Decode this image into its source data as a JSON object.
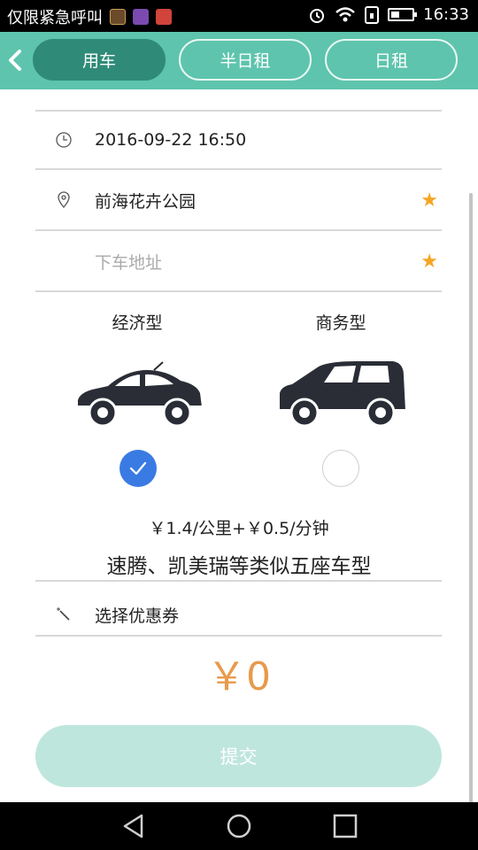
{
  "status_bar": {
    "left_text": "仅限紧急呼叫",
    "time": "16:33",
    "battery_level": 0.4
  },
  "header": {
    "tabs": [
      {
        "label": "用车",
        "active": true
      },
      {
        "label": "半日租",
        "active": false
      },
      {
        "label": "日租",
        "active": false
      }
    ]
  },
  "form": {
    "datetime": "2016-09-22 16:50",
    "pickup": "前海花卉公园",
    "dropoff_placeholder": "下车地址",
    "required_mark": "★"
  },
  "car_types": [
    {
      "label": "经济型",
      "selected": true
    },
    {
      "label": "商务型",
      "selected": false
    }
  ],
  "pricing": {
    "rate": "￥1.4/公里+￥0.5/分钟",
    "models": "速腾、凯美瑞等类似五座车型"
  },
  "coupon": {
    "label": "选择优惠券"
  },
  "total": {
    "amount": "￥0"
  },
  "submit": {
    "label": "提交"
  },
  "colors": {
    "header_bg": "#5ec4ad",
    "active_tab": "#2f8b78",
    "star": "#f5a623",
    "radio_checked": "#3a7be3",
    "price": "#e89a4c",
    "submit_bg": "#bfe6dd"
  }
}
